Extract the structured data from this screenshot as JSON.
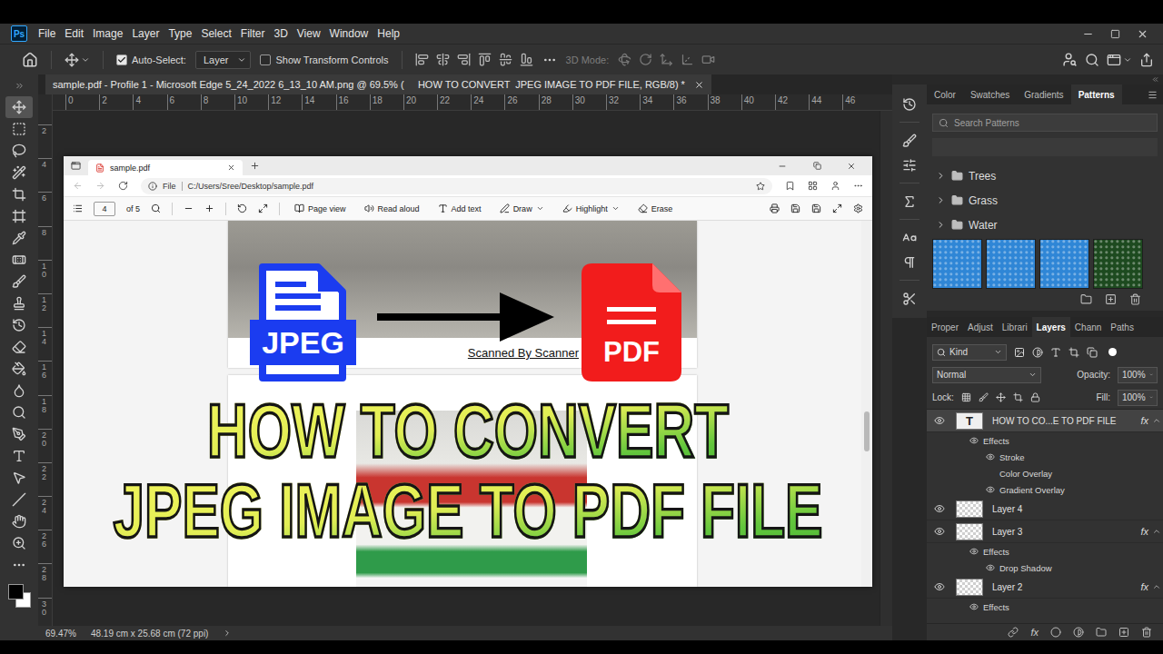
{
  "app": {
    "logo": "Ps",
    "menu": [
      "File",
      "Edit",
      "Image",
      "Layer",
      "Type",
      "Select",
      "Filter",
      "3D",
      "View",
      "Window",
      "Help"
    ]
  },
  "options_bar": {
    "auto_select": {
      "label": "Auto-Select:",
      "checked": true
    },
    "target": "Layer",
    "transform_controls": {
      "label": "Show Transform Controls",
      "checked": false
    },
    "mode_label": "3D Mode:"
  },
  "tools": [
    {
      "selected": true
    },
    {
      "selected": false
    },
    {
      "selected": false
    },
    {
      "selected": false
    },
    {
      "selected": false
    },
    {
      "selected": false
    },
    {
      "selected": false
    },
    {
      "selected": false
    },
    {
      "selected": false
    },
    {
      "selected": false
    },
    {
      "selected": false
    },
    {
      "selected": false
    },
    {
      "selected": false
    },
    {
      "selected": false
    },
    {
      "selected": false
    },
    {
      "selected": false
    },
    {
      "selected": false
    },
    {
      "selected": false
    },
    {
      "selected": false
    },
    {
      "selected": false
    },
    {
      "selected": false
    }
  ],
  "document_tab": {
    "title": "sample.pdf - Profile 1 - Microsoft Edge 5_24_2022 6_13_10 AM.png @ 69.5% (     HOW TO CONVERT  JPEG IMAGE TO PDF FILE, RGB/8) *"
  },
  "rulers": {
    "top": [
      "0",
      "2",
      "4",
      "6",
      "8",
      "10",
      "12",
      "14",
      "16",
      "18",
      "20",
      "22",
      "24",
      "26",
      "28",
      "30",
      "32",
      "34",
      "36",
      "38",
      "40",
      "42",
      "44",
      "46"
    ],
    "left": [
      "2",
      "4",
      "6",
      "8",
      "10",
      "12",
      "14",
      "16",
      "18",
      "20",
      "22",
      "24",
      "26",
      "28",
      "30"
    ]
  },
  "browser": {
    "tab": "sample.pdf",
    "scheme": "File",
    "address": "C:/Users/Sree/Desktop/sample.pdf",
    "page": "4",
    "page_total": "of 5",
    "tools": [
      {
        "label": "Page view",
        "has_menu": false
      },
      {
        "label": "Read aloud",
        "has_menu": false
      },
      {
        "label": "Add text",
        "has_menu": false
      },
      {
        "label": "Draw",
        "has_menu": true
      },
      {
        "label": "Highlight",
        "has_menu": true
      },
      {
        "label": "Erase",
        "has_menu": false
      }
    ]
  },
  "pdf": {
    "caption": "Scanned By Scanner"
  },
  "thumbnail": {
    "from_label": "JPEG",
    "to_label": "PDF",
    "title": [
      "HOW TO CONVERT",
      "JPEG IMAGE TO PDF FILE"
    ]
  },
  "status_bar": {
    "zoom": "69.47%",
    "doc_size": "48.19 cm x 25.68 cm (72 ppi)"
  },
  "patterns_panel": {
    "tabs": [
      {
        "label": "Color",
        "selected": false
      },
      {
        "label": "Swatches",
        "selected": false
      },
      {
        "label": "Gradients",
        "selected": false
      },
      {
        "label": "Patterns",
        "selected": true
      }
    ],
    "search_placeholder": "Search Patterns",
    "folders": [
      {
        "name": "Trees",
        "expanded": false
      },
      {
        "name": "Grass",
        "expanded": false
      },
      {
        "name": "Water",
        "expanded": false
      }
    ],
    "swatches": [
      {
        "color": "#2f86d6"
      },
      {
        "color": "#2f86d6"
      },
      {
        "color": "#2f86d6"
      },
      {
        "color": "#1d4a1f"
      }
    ]
  },
  "layers_panel": {
    "tabs": [
      {
        "label": "Proper",
        "selected": false
      },
      {
        "label": "Adjust",
        "selected": false
      },
      {
        "label": "Librari",
        "selected": false
      },
      {
        "label": "Layers",
        "selected": true
      },
      {
        "label": "Chann",
        "selected": false
      },
      {
        "label": "Paths",
        "selected": false
      }
    ],
    "filter": "Kind",
    "blend_mode": "Normal",
    "opacity_label": "Opacity:",
    "opacity": "100%",
    "lock_label": "Lock:",
    "fill_label": "Fill:",
    "fill": "100%",
    "fx_button": "fx",
    "layers": [
      {
        "kind": "layer",
        "name": "HOW TO CO...E TO PDF FILE",
        "thumb": "T",
        "fx": "fx",
        "visible": true,
        "selected": true,
        "expanded": true
      },
      {
        "kind": "effects",
        "name": "Effects",
        "visible": true
      },
      {
        "kind": "effect",
        "name": "Stroke",
        "visible": true
      },
      {
        "kind": "effect",
        "name": "Color Overlay",
        "visible": false
      },
      {
        "kind": "effect",
        "name": "Gradient Overlay",
        "visible": true
      },
      {
        "kind": "layer",
        "name": "Layer 4",
        "visible": true,
        "selected": false
      },
      {
        "kind": "layer",
        "name": "Layer 3",
        "fx": "fx",
        "visible": true,
        "selected": false,
        "expanded": true
      },
      {
        "kind": "effects",
        "name": "Effects",
        "visible": true
      },
      {
        "kind": "effect",
        "name": "Drop Shadow",
        "visible": true
      },
      {
        "kind": "layer",
        "name": "Layer 2",
        "fx": "fx",
        "visible": true,
        "selected": false,
        "expanded": true
      },
      {
        "kind": "effects",
        "name": "Effects",
        "visible": true
      }
    ]
  }
}
